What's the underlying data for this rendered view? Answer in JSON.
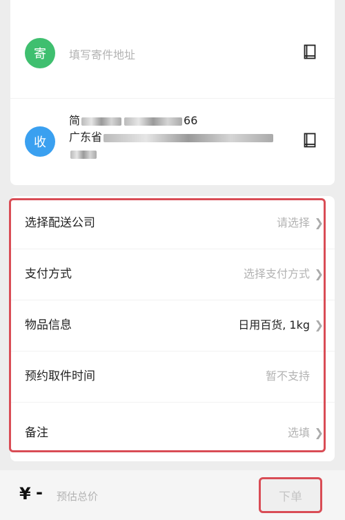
{
  "sender": {
    "badge": "寄",
    "placeholder": "填写寄件地址"
  },
  "receiver": {
    "badge": "收",
    "name_prefix": "简",
    "phone_suffix": "66",
    "address_prefix": "广东省"
  },
  "options": [
    {
      "label": "选择配送公司",
      "value": "请选择",
      "value_style": "muted",
      "chevron": true
    },
    {
      "label": "支付方式",
      "value": "选择支付方式",
      "value_style": "muted",
      "chevron": true
    },
    {
      "label": "物品信息",
      "value": "日用百货, 1kg",
      "value_style": "dark",
      "chevron": true
    },
    {
      "label": "预约取件时间",
      "value": "暂不支持",
      "value_style": "muted",
      "chevron": false
    },
    {
      "label": "备注",
      "value": "选填",
      "value_style": "muted",
      "chevron": true
    }
  ],
  "bottom": {
    "currency": "¥",
    "price": "-",
    "price_label": "预估总价",
    "order_button": "下单"
  },
  "colors": {
    "send_badge": "#3fbf6f",
    "recv_badge": "#3aa0f0",
    "highlight": "#d94c55"
  }
}
